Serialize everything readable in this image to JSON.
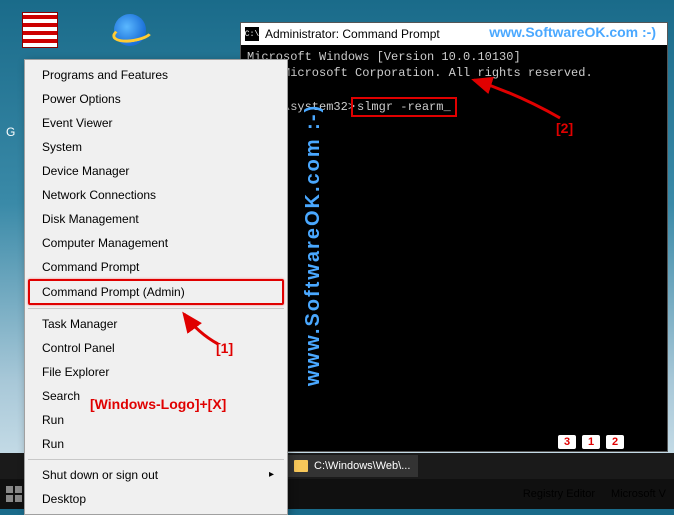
{
  "cmd": {
    "title": "Administrator: Command Prompt",
    "line1_left": "Microsoft Windows [Version 10.0.10130]",
    "line2": "2015 Microsoft Corporation. All rights reserved.",
    "prompt_left": "NDOWS\\system32>",
    "command": "slmgr -rearm",
    "cursor": "_"
  },
  "menu": {
    "items": [
      "Programs and Features",
      "Power Options",
      "Event Viewer",
      "System",
      "Device Manager",
      "Network Connections",
      "Disk Management",
      "Computer Management",
      "Command Prompt",
      "Command Prompt (Admin)"
    ],
    "items2": [
      "Task Manager",
      "Control Panel",
      "File Explorer",
      "Search",
      "Run",
      "Run"
    ],
    "items3": [
      "Shut down or sign out",
      "Desktop"
    ],
    "submenu_arrow": "▸"
  },
  "annotations": {
    "one": "[1]",
    "two": "[2]",
    "wx": "[Windows-Logo]+[X]",
    "watermark": "www.SoftwareOK.com :-)",
    "watermark_vert": "www.SoftwareOK.com :-)"
  },
  "taskbar": {
    "explorer_item": "C:\\Windows\\Web\\...",
    "regedit": "Registry Editor",
    "msv": "Microsoft V"
  },
  "figures": [
    "3",
    "1",
    "2"
  ],
  "cmd_icon_text": "C:\\",
  "g_letter": "G"
}
